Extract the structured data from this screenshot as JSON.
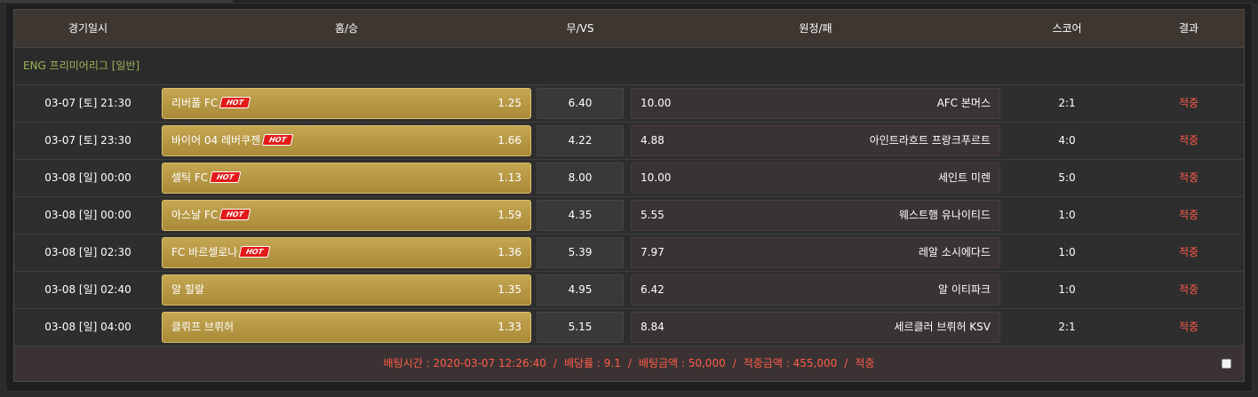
{
  "header": {
    "date": "경기일시",
    "home": "홈/승",
    "draw": "무/VS",
    "away": "원정/패",
    "score": "스코어",
    "result": "결과"
  },
  "league": "ENG 프리미어리그 [일반]",
  "hot_label": "HOT",
  "colors": {
    "accent_gold": "#c5a752",
    "result_red": "#ff5a4a",
    "league_green": "#9ab556",
    "hot_badge": "#e31a1a"
  },
  "rows": [
    {
      "date": "03-07 [토] 21:30",
      "home": "리버풀 FC",
      "hot": true,
      "home_odds": "1.25",
      "draw_odds": "6.40",
      "away_odds": "10.00",
      "away": "AFC 본머스",
      "score": "2:1",
      "result": "적중"
    },
    {
      "date": "03-07 [토] 23:30",
      "home": "바이어 04 레버쿠젠",
      "hot": true,
      "home_odds": "1.66",
      "draw_odds": "4.22",
      "away_odds": "4.88",
      "away": "아인트라흐트 프랑크푸르트",
      "score": "4:0",
      "result": "적중"
    },
    {
      "date": "03-08 [일] 00:00",
      "home": "셀틱 FC",
      "hot": true,
      "home_odds": "1.13",
      "draw_odds": "8.00",
      "away_odds": "10.00",
      "away": "세인트 미렌",
      "score": "5:0",
      "result": "적중"
    },
    {
      "date": "03-08 [일] 00:00",
      "home": "아스날 FC",
      "hot": true,
      "home_odds": "1.59",
      "draw_odds": "4.35",
      "away_odds": "5.55",
      "away": "웨스트햄 유나이티드",
      "score": "1:0",
      "result": "적중"
    },
    {
      "date": "03-08 [일] 02:30",
      "home": "FC 바르셀로나",
      "hot": true,
      "home_odds": "1.36",
      "draw_odds": "5.39",
      "away_odds": "7.97",
      "away": "레알 소시에다드",
      "score": "1:0",
      "result": "적중"
    },
    {
      "date": "03-08 [일] 02:40",
      "home": "알 힐랄",
      "hot": false,
      "home_odds": "1.35",
      "draw_odds": "4.95",
      "away_odds": "6.42",
      "away": "알 이티파크",
      "score": "1:0",
      "result": "적중"
    },
    {
      "date": "03-08 [일] 04:00",
      "home": "클뤼프 브뤼허",
      "hot": false,
      "home_odds": "1.33",
      "draw_odds": "5.15",
      "away_odds": "8.84",
      "away": "세르클러 브뤼허 KSV",
      "score": "2:1",
      "result": "적중"
    }
  ],
  "footer": {
    "bet_time": "배팅시간 : 2020-03-07 12:26:40",
    "bet_rate": "배당률 : 9.1",
    "bet_amount": "배팅금액 : 50,000",
    "win_amount": "적중금액 : 455,000",
    "status": "적중",
    "separator": "/"
  }
}
